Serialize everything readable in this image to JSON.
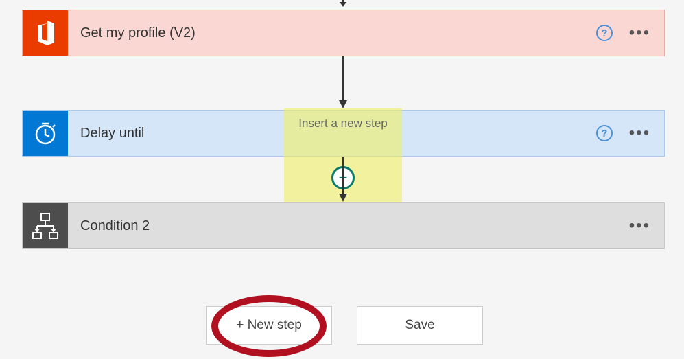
{
  "steps": [
    {
      "label": "Get my profile (V2)",
      "has_help": true,
      "icon_bg": "#eb3c00"
    },
    {
      "label": "Delay until",
      "has_help": true,
      "icon_bg": "#0078d4"
    },
    {
      "label": "Condition 2",
      "has_help": false,
      "icon_bg": "#4d4d4d"
    }
  ],
  "insert_tooltip": "Insert a new step",
  "buttons": {
    "new_step": "+ New step",
    "save": "Save"
  },
  "highlight": "new_step"
}
